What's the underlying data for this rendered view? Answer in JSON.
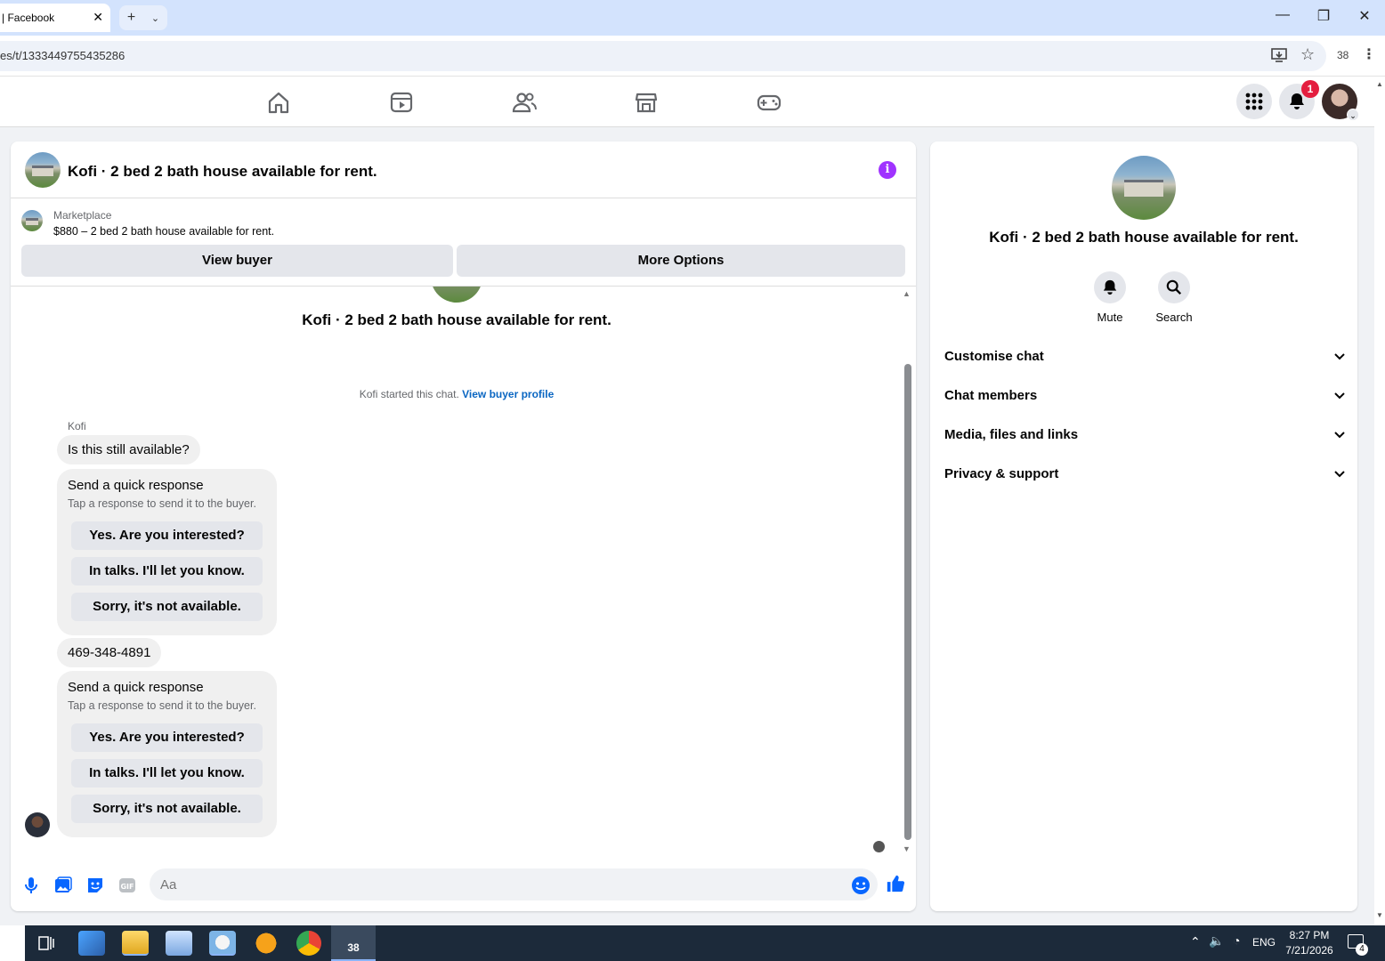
{
  "browser": {
    "tab_title": "| Facebook",
    "url": "es/t/1333449755435286",
    "extensions_count": "38"
  },
  "nav": {
    "notification_count": "1"
  },
  "chat": {
    "title": "Kofi · 2 bed 2 bath house available for rent.",
    "marketplace_label": "Marketplace",
    "listing": "$880 – 2 bed 2 bath house available for rent.",
    "view_buyer_label": "View buyer",
    "more_options_label": "More Options",
    "thread_title": "Kofi · 2 bed 2 bath house available for rent.",
    "started_note": "Kofi started this chat.",
    "view_buyer_profile_link": "View buyer profile",
    "sender_name": "Kofi",
    "messages": [
      {
        "text": "Is this still available?"
      },
      {
        "text": "469-348-4891"
      }
    ],
    "quick_responses": [
      {
        "title": "Send a quick response",
        "subtitle": "Tap a response to send it to the buyer.",
        "options": [
          "Yes. Are you interested?",
          "In talks. I'll let you know.",
          "Sorry, it's not available."
        ]
      },
      {
        "title": "Send a quick response",
        "subtitle": "Tap a response to send it to the buyer.",
        "options": [
          "Yes. Are you interested?",
          "In talks. I'll let you know.",
          "Sorry, it's not available."
        ]
      }
    ],
    "composer_placeholder": "Aa"
  },
  "side_panel": {
    "name": "Kofi · 2 bed 2 bath house available for rent.",
    "mute_label": "Mute",
    "search_label": "Search",
    "sections": [
      "Customise chat",
      "Chat members",
      "Media, files and links",
      "Privacy & support"
    ]
  },
  "taskbar": {
    "time": "8:27 PM",
    "date": "7/21/2026",
    "language": "ENG",
    "app_badge": "38",
    "notification_count": "4"
  },
  "colors": {
    "accent_blue": "#0866ff",
    "info_purple": "#a033ff",
    "badge_red": "#e41e3f"
  }
}
